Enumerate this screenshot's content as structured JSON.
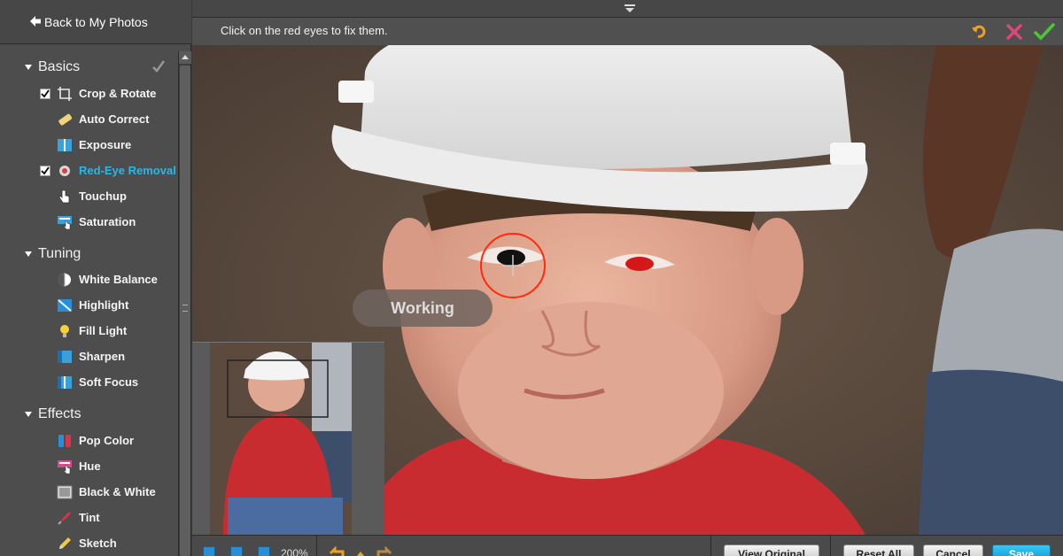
{
  "sidebar": {
    "back_label": "Back to My Photos",
    "sections": [
      {
        "title": "Basics",
        "tools": [
          {
            "label": "Crop & Rotate",
            "checked": true,
            "icon": "crop-icon"
          },
          {
            "label": "Auto Correct",
            "checked": false,
            "icon": "wand-icon"
          },
          {
            "label": "Exposure",
            "checked": false,
            "icon": "exposure-icon"
          },
          {
            "label": "Red-Eye Removal",
            "checked": true,
            "active": true,
            "icon": "red-eye-icon"
          },
          {
            "label": "Touchup",
            "checked": false,
            "icon": "touchup-hand-icon"
          },
          {
            "label": "Saturation",
            "checked": false,
            "icon": "saturation-icon"
          }
        ]
      },
      {
        "title": "Tuning",
        "tools": [
          {
            "label": "White Balance",
            "icon": "white-balance-icon"
          },
          {
            "label": "Highlight",
            "icon": "highlight-icon"
          },
          {
            "label": "Fill Light",
            "icon": "bulb-icon"
          },
          {
            "label": "Sharpen",
            "icon": "sharpen-icon"
          },
          {
            "label": "Soft Focus",
            "icon": "soft-focus-icon"
          }
        ]
      },
      {
        "title": "Effects",
        "tools": [
          {
            "label": "Pop Color",
            "icon": "pop-color-icon"
          },
          {
            "label": "Hue",
            "icon": "hue-icon"
          },
          {
            "label": "Black & White",
            "icon": "black-white-icon"
          },
          {
            "label": "Tint",
            "icon": "tint-dropper-icon"
          },
          {
            "label": "Sketch",
            "icon": "pencil-icon"
          }
        ]
      }
    ]
  },
  "toolbar": {
    "instruction": "Click on the red eyes to fix them.",
    "accent": "#29b6e8"
  },
  "canvas": {
    "status_text": "Working"
  },
  "footer": {
    "zoom_level": "200%",
    "view_original": "View Original",
    "reset_all": "Reset All",
    "cancel": "Cancel",
    "save": "Save"
  }
}
